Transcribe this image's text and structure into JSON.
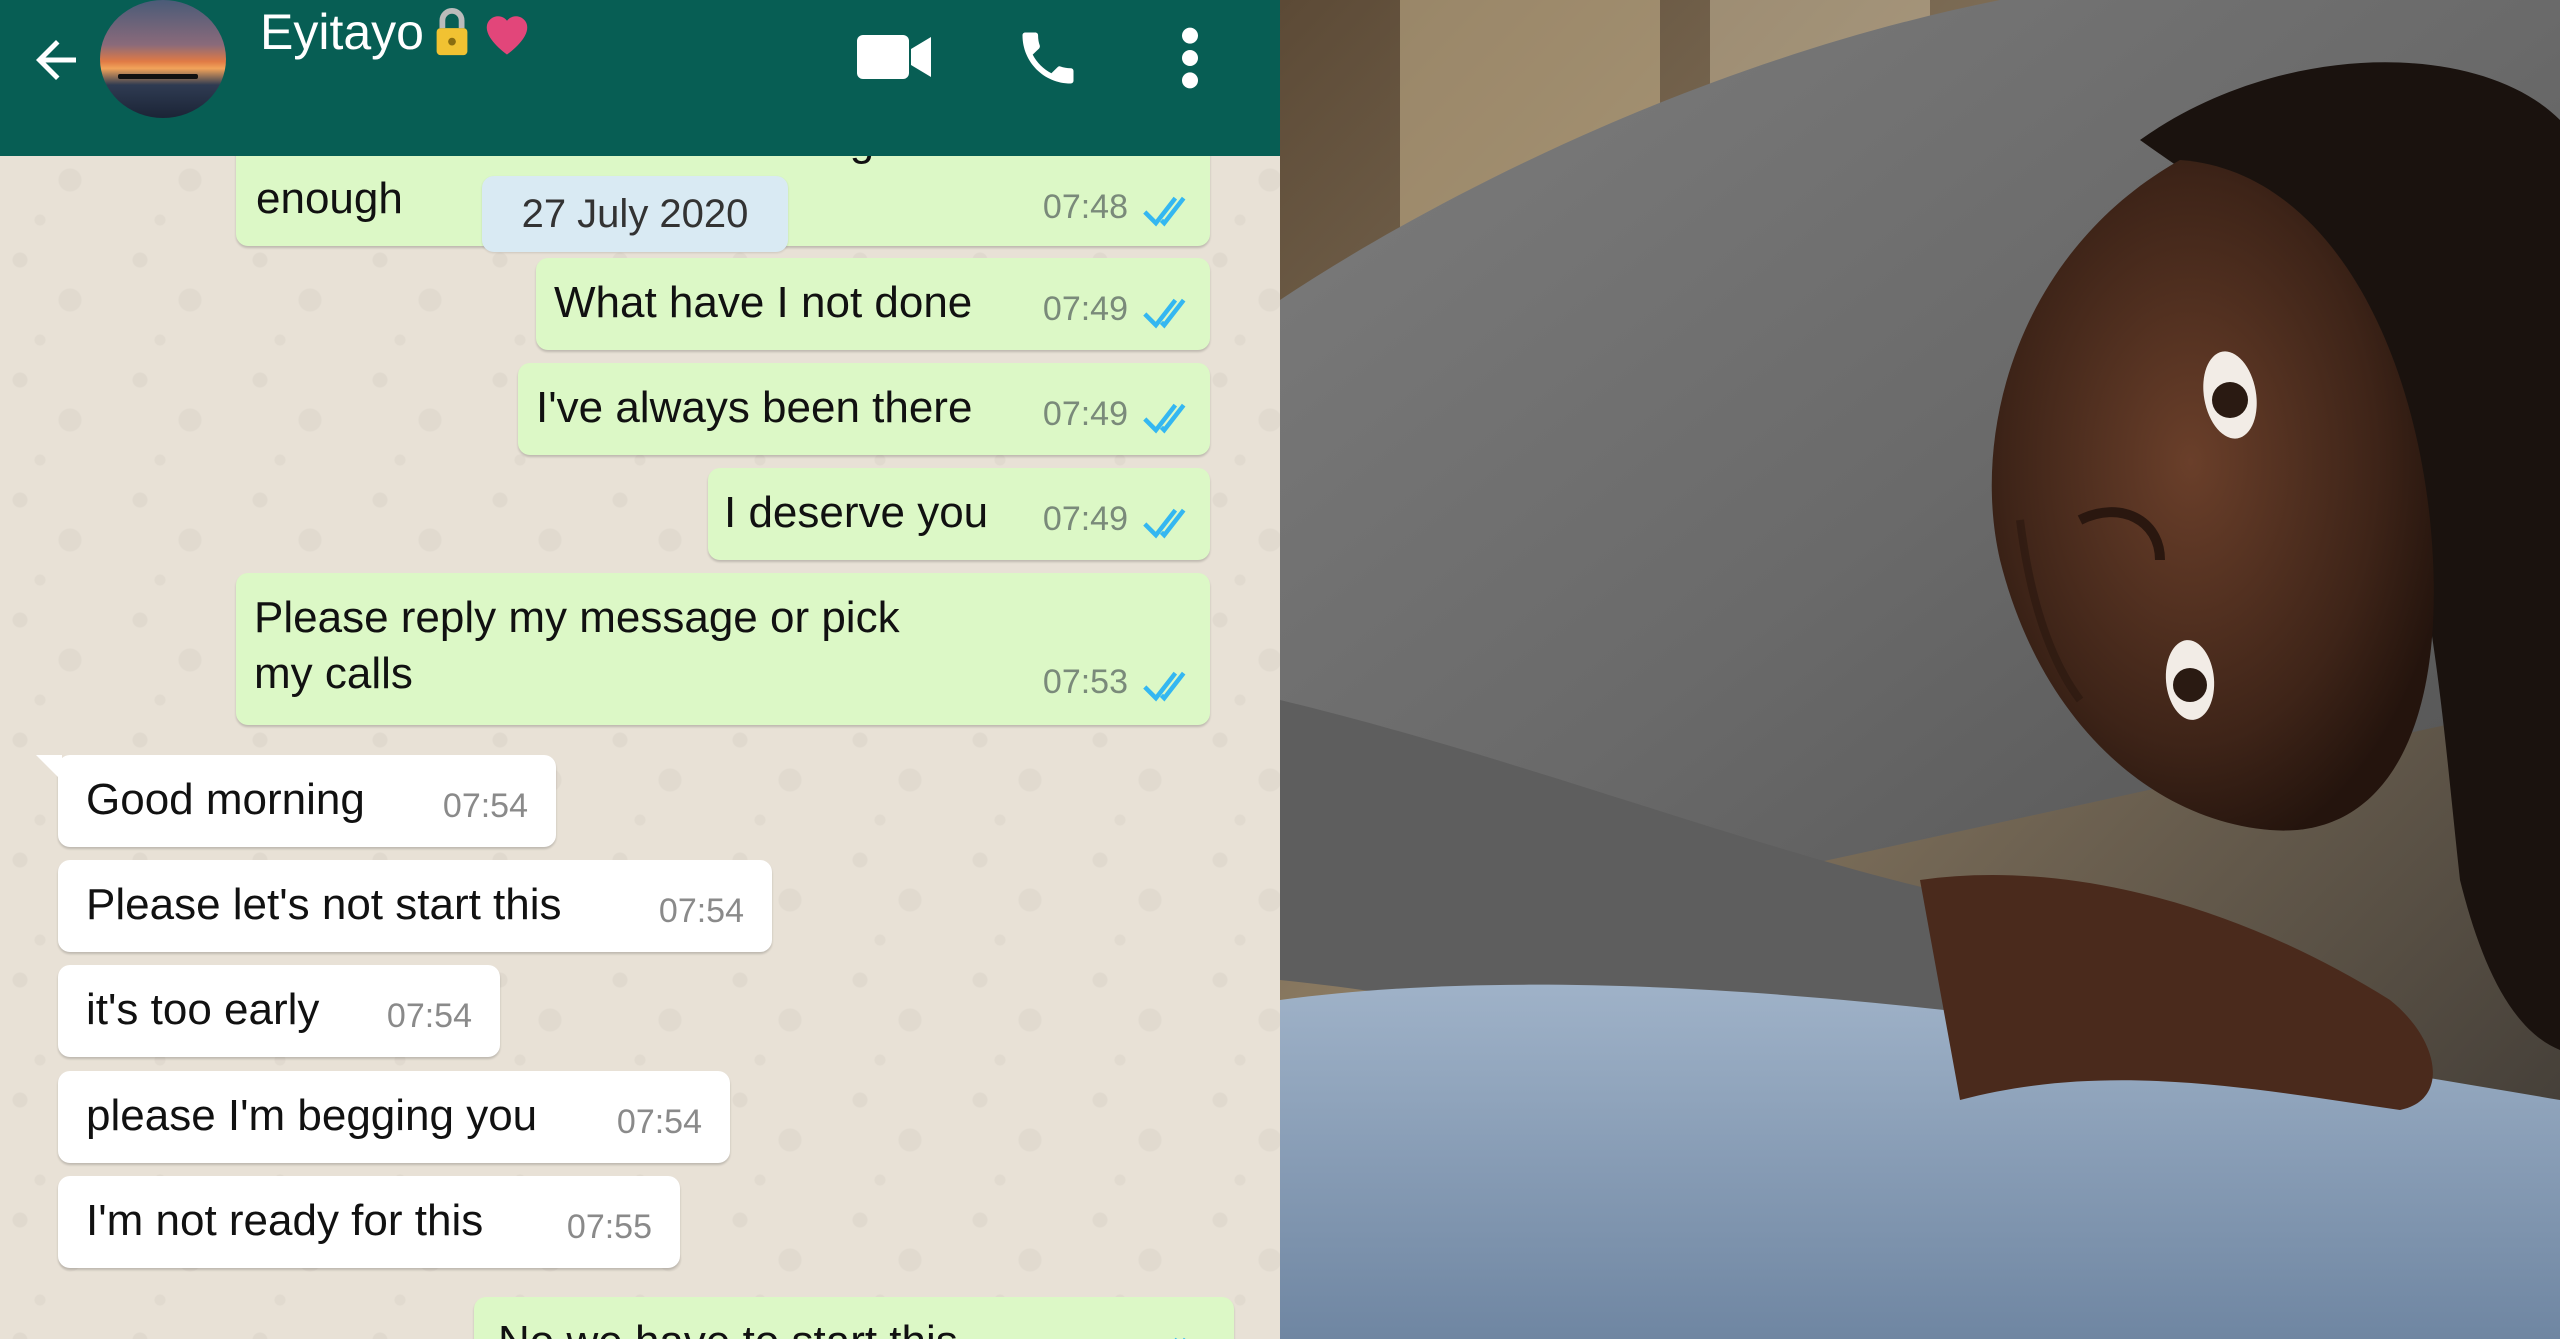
{
  "header": {
    "contact_name": "Eyitayo",
    "icons": [
      "back-arrow-icon",
      "avatar",
      "lock-icon",
      "heart-icon",
      "video-call-icon",
      "phone-icon",
      "more-icon"
    ],
    "color": "#075e54"
  },
  "date_chip": "27 July 2020",
  "messages": [
    {
      "text": "You make feel like I'm not doing",
      "text2": "enough",
      "time": "07:48",
      "dir": "out"
    },
    {
      "text": "What have I not done",
      "time": "07:49",
      "dir": "out"
    },
    {
      "text": "I've always been there",
      "time": "07:49",
      "dir": "out"
    },
    {
      "text": "I deserve you",
      "time": "07:49",
      "dir": "out"
    },
    {
      "text": "Please reply my message or pick",
      "text2": "my calls",
      "time": "07:53",
      "dir": "out"
    },
    {
      "text": "Good morning",
      "time": "07:54",
      "dir": "in"
    },
    {
      "text": "Please let's not start this",
      "time": "07:54",
      "dir": "in"
    },
    {
      "text": "it's too early",
      "time": "07:54",
      "dir": "in"
    },
    {
      "text": "please I'm begging you",
      "time": "07:54",
      "dir": "in"
    },
    {
      "text": "I'm not ready for this",
      "time": "07:55",
      "dir": "in"
    },
    {
      "text": "No we have to start this",
      "dir": "out"
    }
  ],
  "colors": {
    "outgoing_bubble": "#dcf8c6",
    "incoming_bubble": "#ffffff",
    "read_ticks": "#34b7f1",
    "chat_background": "#e8e1d6"
  }
}
